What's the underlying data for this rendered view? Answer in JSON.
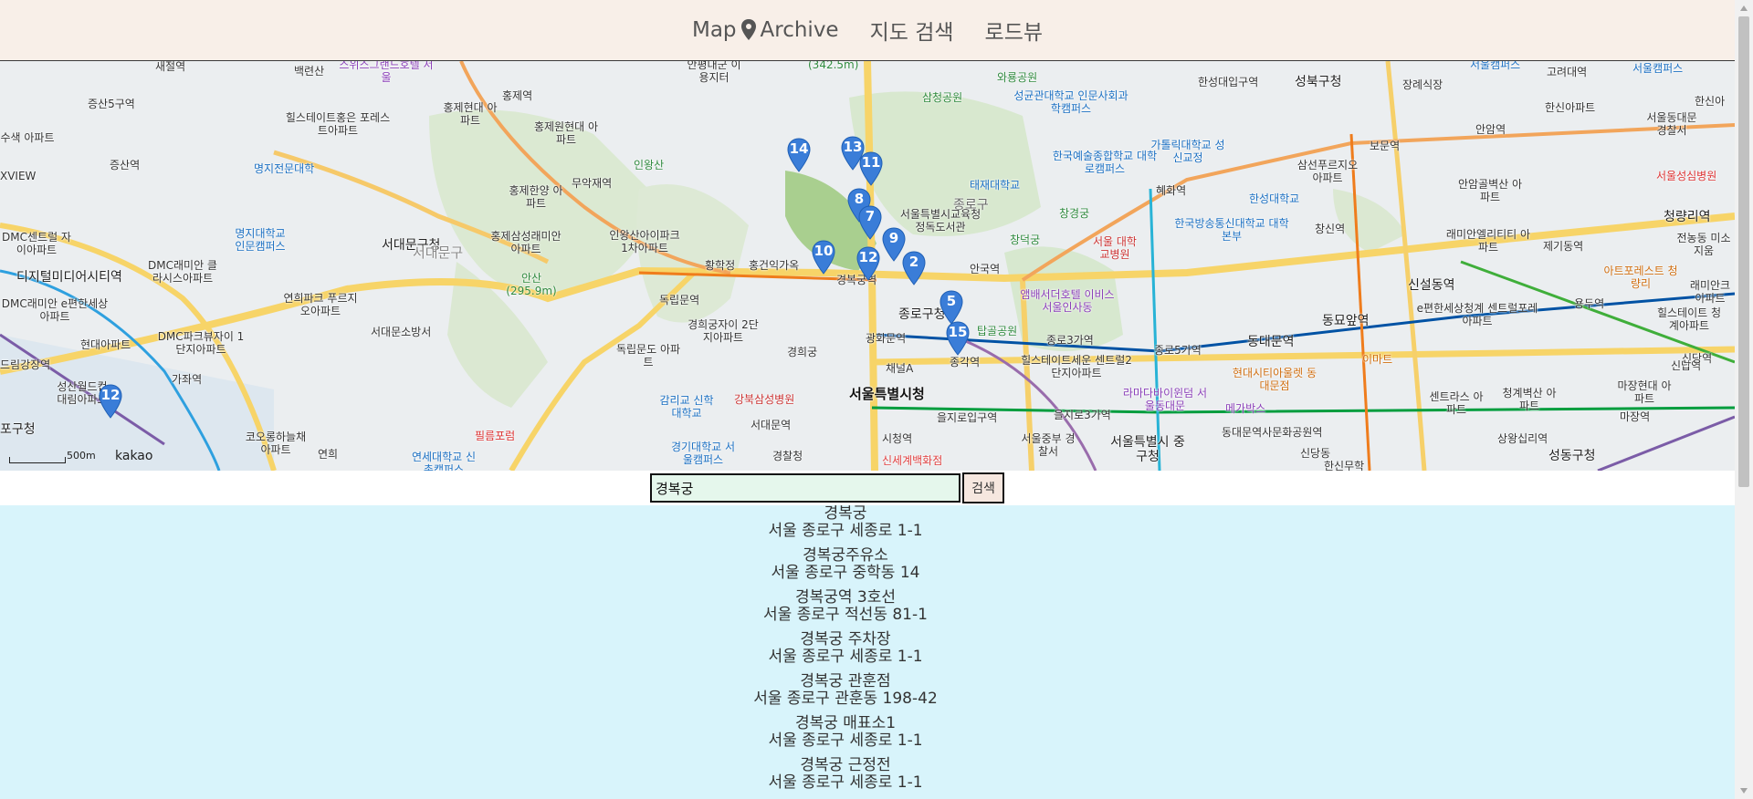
{
  "header": {
    "brand_left": "Map",
    "brand_right": "Archive",
    "nav": [
      "지도 검색",
      "로드뷰"
    ]
  },
  "map": {
    "labels": [
      {
        "t": "백련산"
      },
      {
        "t": "스위스그랜드호텔 서울"
      },
      {
        "t": "새절역"
      },
      {
        "t": "증산5구역"
      },
      {
        "t": "홍제역"
      },
      {
        "t": "홍제현대 아파트"
      },
      {
        "t": "홍제원현대 아파트"
      },
      {
        "t": "힐스테이트홍은 포레스트아파트"
      },
      {
        "t": "홍제한양 아파트"
      },
      {
        "t": "무악재역"
      },
      {
        "t": "인왕산"
      },
      {
        "t": "안평대군 이용지터"
      },
      {
        "t": "(342.5m)"
      },
      {
        "t": "와룡공원"
      },
      {
        "t": "삼청공원"
      },
      {
        "t": "성균관대학교 인문사회과학캠퍼스"
      },
      {
        "t": "한성대입구역"
      },
      {
        "t": "성북구청"
      },
      {
        "t": "장례식장"
      },
      {
        "t": "서울캠퍼스"
      },
      {
        "t": "고려대역"
      },
      {
        "t": "한신아파트"
      },
      {
        "t": "서울캠퍼스"
      },
      {
        "t": "서울동대문 경찰서"
      },
      {
        "t": "증산역"
      },
      {
        "t": "명지전문대학"
      },
      {
        "t": "명지대학교 인문캠퍼스"
      },
      {
        "t": "서대문구청"
      },
      {
        "t": "서대문구"
      },
      {
        "t": "홍제삼성래미안 아파트"
      },
      {
        "t": "인왕산아이파크 1차아파트"
      },
      {
        "t": "황학정"
      },
      {
        "t": "홍건익가옥"
      },
      {
        "t": "경복궁역"
      },
      {
        "t": "종로구"
      },
      {
        "t": "서울특별시교육청 정독도서관"
      },
      {
        "t": "안국역"
      },
      {
        "t": "창경궁"
      },
      {
        "t": "창덕궁"
      },
      {
        "t": "서울 대학교병원"
      },
      {
        "t": "혜화역"
      },
      {
        "t": "태재대학교"
      },
      {
        "t": "한국예술종합학교 대학로캠퍼스"
      },
      {
        "t": "가톨릭대학교 성신교정"
      },
      {
        "t": "한성대학교"
      },
      {
        "t": "한국방송통신대학교 대학본부"
      },
      {
        "t": "보문역"
      },
      {
        "t": "삼선푸르지오 아파트"
      },
      {
        "t": "안암역"
      },
      {
        "t": "안암골벽산 아파트"
      },
      {
        "t": "창신역"
      },
      {
        "t": "래미안엘리티티 아파트"
      },
      {
        "t": "제기동역"
      },
      {
        "t": "청량리역"
      },
      {
        "t": "서울성심병원"
      },
      {
        "t": "DMC센트럴 자이아파트"
      },
      {
        "t": "디지털미디어시티역"
      },
      {
        "t": "DMC래미안 클라시스아파트"
      },
      {
        "t": "DMC래미안 e편한세상아파트"
      },
      {
        "t": "연희파크 푸르지오아파트"
      },
      {
        "t": "안산 (295.9m)"
      },
      {
        "t": "독립문역"
      },
      {
        "t": "경희궁자이 2단지아파트"
      },
      {
        "t": "독립문도 아파트"
      },
      {
        "t": "종로구청"
      },
      {
        "t": "광화문역"
      },
      {
        "t": "앰배서더호텔 이비스 서울인사동"
      },
      {
        "t": "탑골공원"
      },
      {
        "t": "종로3가역"
      },
      {
        "t": "종로5가역"
      },
      {
        "t": "동대문역"
      },
      {
        "t": "동묘앞역"
      },
      {
        "t": "신설동역"
      },
      {
        "t": "e편한세상청계 센트럴포레아파트"
      },
      {
        "t": "용두역"
      },
      {
        "t": "이마트"
      },
      {
        "t": "현대아파트"
      },
      {
        "t": "DMC파크뷰자이 1단지아파트"
      },
      {
        "t": "서대문소방서"
      },
      {
        "t": "경희궁"
      },
      {
        "t": "강북삼성병원"
      },
      {
        "t": "감리교 신학대학교"
      },
      {
        "t": "서대문역"
      },
      {
        "t": "채널A"
      },
      {
        "t": "서울특별시청"
      },
      {
        "t": "종각역"
      },
      {
        "t": "힐스테이트세운 센트럴2단지아파트"
      },
      {
        "t": "현대시티아울렛 동대문점"
      },
      {
        "t": "라마다바이윈덤 서울동대문"
      },
      {
        "t": "메가박스"
      },
      {
        "t": "드림강장역"
      },
      {
        "t": "성산월드컵 대림아파트"
      },
      {
        "t": "가좌역"
      },
      {
        "t": "포구청"
      },
      {
        "t": "코오롱하늘채 아파트"
      },
      {
        "t": "연희"
      },
      {
        "t": "필름포럼"
      },
      {
        "t": "연세대학교 신촌캠퍼스"
      },
      {
        "t": "경기대학교 서울캠퍼스"
      },
      {
        "t": "경찰청"
      },
      {
        "t": "시청역"
      },
      {
        "t": "신세계백화점"
      },
      {
        "t": "을지로입구역"
      },
      {
        "t": "을지로3가역"
      },
      {
        "t": "서울중부 경찰서"
      },
      {
        "t": "서울특별시 중구청"
      },
      {
        "t": "동대문역사문화공원역"
      },
      {
        "t": "신당동"
      },
      {
        "t": "센트라스 아파트"
      },
      {
        "t": "청계벽산 아파트"
      },
      {
        "t": "상왕십리역"
      },
      {
        "t": "성동구청"
      },
      {
        "t": "마장현대 아파트"
      },
      {
        "t": "마장역"
      },
      {
        "t": "힐스테이트 청계아파트"
      },
      {
        "t": "신답역"
      },
      {
        "t": "아트포레스트 청량리"
      },
      {
        "t": "전농동 미소지움"
      },
      {
        "t": "래미안크 아파트"
      },
      {
        "t": "수색 아파트"
      },
      {
        "t": "XVIEW"
      },
      {
        "t": "한신아"
      },
      {
        "t": "한신무학"
      },
      {
        "t": "신당역"
      },
      {
        "t": "상신"
      },
      {
        "t": "무학봉"
      },
      {
        "t": "세운드 호텔"
      },
      {
        "t": "용답역"
      },
      {
        "t": "고대역"
      },
      {
        "t": "안암역"
      },
      {
        "t": "홍은"
      },
      {
        "t": "IC"
      }
    ],
    "markers": [
      "14",
      "13",
      "11",
      "8",
      "7",
      "9",
      "10",
      "12",
      "2",
      "5",
      "15",
      "12"
    ],
    "scale_label": "500m",
    "attribution": "kakao",
    "brand_color": "#3a7dd8"
  },
  "search": {
    "value": "경복궁",
    "placeholder": "",
    "button_label": "검색"
  },
  "results": [
    {
      "name": "경복궁",
      "address": "서울 종로구 세종로 1-1"
    },
    {
      "name": "경복궁주유소",
      "address": "서울 종로구 중학동 14"
    },
    {
      "name": "경복궁역 3호선",
      "address": "서울 종로구 적선동 81-1"
    },
    {
      "name": "경복궁 주차장",
      "address": "서울 종로구 세종로 1-1"
    },
    {
      "name": "경복궁 관훈점",
      "address": "서울 종로구 관훈동 198-42"
    },
    {
      "name": "경복궁 매표소1",
      "address": "서울 종로구 세종로 1-1"
    },
    {
      "name": "경복궁 근정전",
      "address": "서울 종로구 세종로 1-1"
    }
  ]
}
